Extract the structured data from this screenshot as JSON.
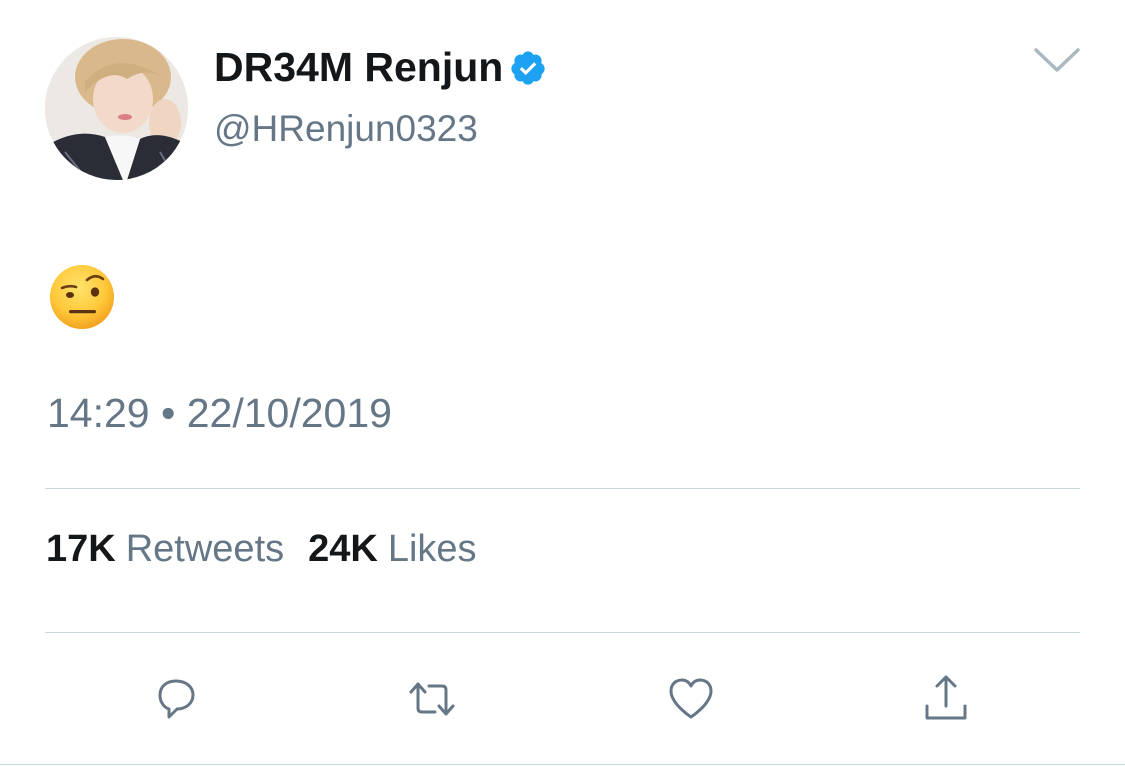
{
  "user": {
    "display_name": "DR34M Renjun",
    "handle": "@HRenjun0323",
    "verified": true,
    "avatar_icon": "profile-photo"
  },
  "tweet": {
    "content_emoji": "face-with-raised-eyebrow",
    "timestamp": "14:29 • 22/10/2019"
  },
  "stats": {
    "retweets_count": "17K",
    "retweets_label": "Retweets",
    "likes_count": "24K",
    "likes_label": "Likes"
  },
  "actions": {
    "reply_icon": "reply-icon",
    "retweet_icon": "retweet-icon",
    "like_icon": "heart-icon",
    "share_icon": "share-icon"
  },
  "colors": {
    "text_primary": "#14171a",
    "text_secondary": "#657786",
    "verified_blue": "#1da1f2",
    "divider": "#ccd6dd",
    "icon_gray": "#657786"
  }
}
